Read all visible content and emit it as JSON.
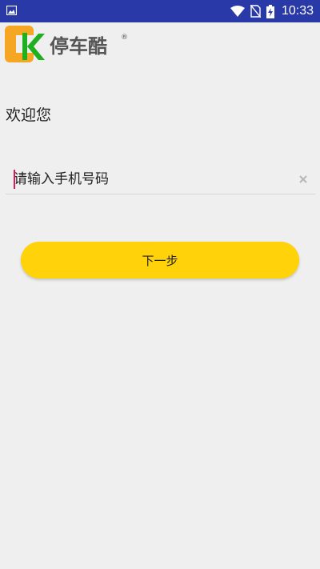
{
  "status_bar": {
    "time": "10:33",
    "icons": [
      "image-icon",
      "wifi-icon",
      "no-sim-icon",
      "battery-charging-icon"
    ]
  },
  "logo": {
    "text": "停车酷",
    "mark": "®"
  },
  "welcome": "欢迎您",
  "phone": {
    "placeholder": "请输入手机号码",
    "value": ""
  },
  "next_button_label": "下一步",
  "colors": {
    "status_bar": "#2a39a8",
    "background": "#efefef",
    "button": "#ffd20a",
    "cursor": "#d81b60",
    "logo_orange": "#f5a623",
    "logo_green": "#1fb01f"
  }
}
